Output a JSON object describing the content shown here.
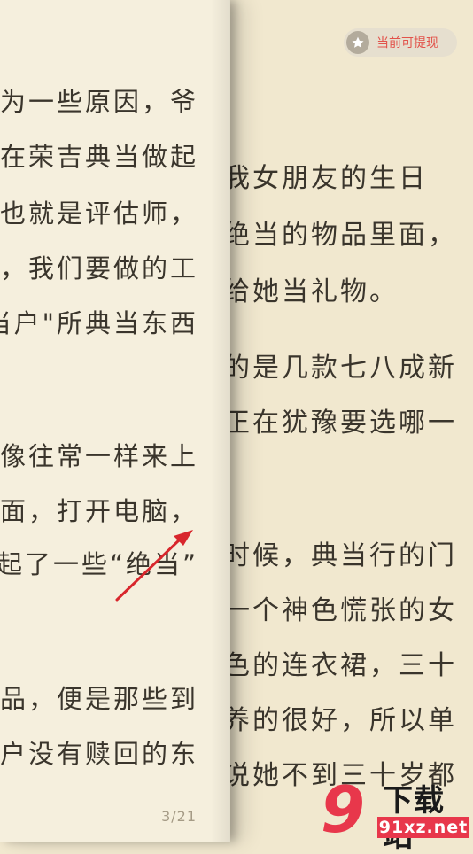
{
  "reader": {
    "left_page_lines": [
      "为一些原因，爷",
      "在荣吉典当做起",
      "也就是评估师，",
      "，我们要做的工",
      "当户\"所典当东西",
      "像往常一样来上",
      "面，打开电脑，",
      "起了一些“绝当”",
      "品，便是那些到",
      "户没有赎回的东"
    ],
    "right_page_lines": [
      "我女朋友的生日",
      "绝当的物品里面，",
      "给她当礼物。",
      "的是几款七八成新",
      "正在犹豫要选哪一",
      "时候，典当行的门",
      "一个神色慌张的女",
      "色的连衣裙，三十",
      "养的很好，所以单",
      "说她不到三十岁都"
    ],
    "page_indicator": "3/21"
  },
  "withdraw_badge": {
    "label": "当前可提现",
    "icon": "star-icon",
    "label_color": "#e2534b"
  },
  "annotation": {
    "icon": "red-arrow-icon",
    "color": "#d8262c"
  },
  "watermark": {
    "logo_numeral": "9",
    "title": "下载站",
    "url": "91xz.net"
  }
}
